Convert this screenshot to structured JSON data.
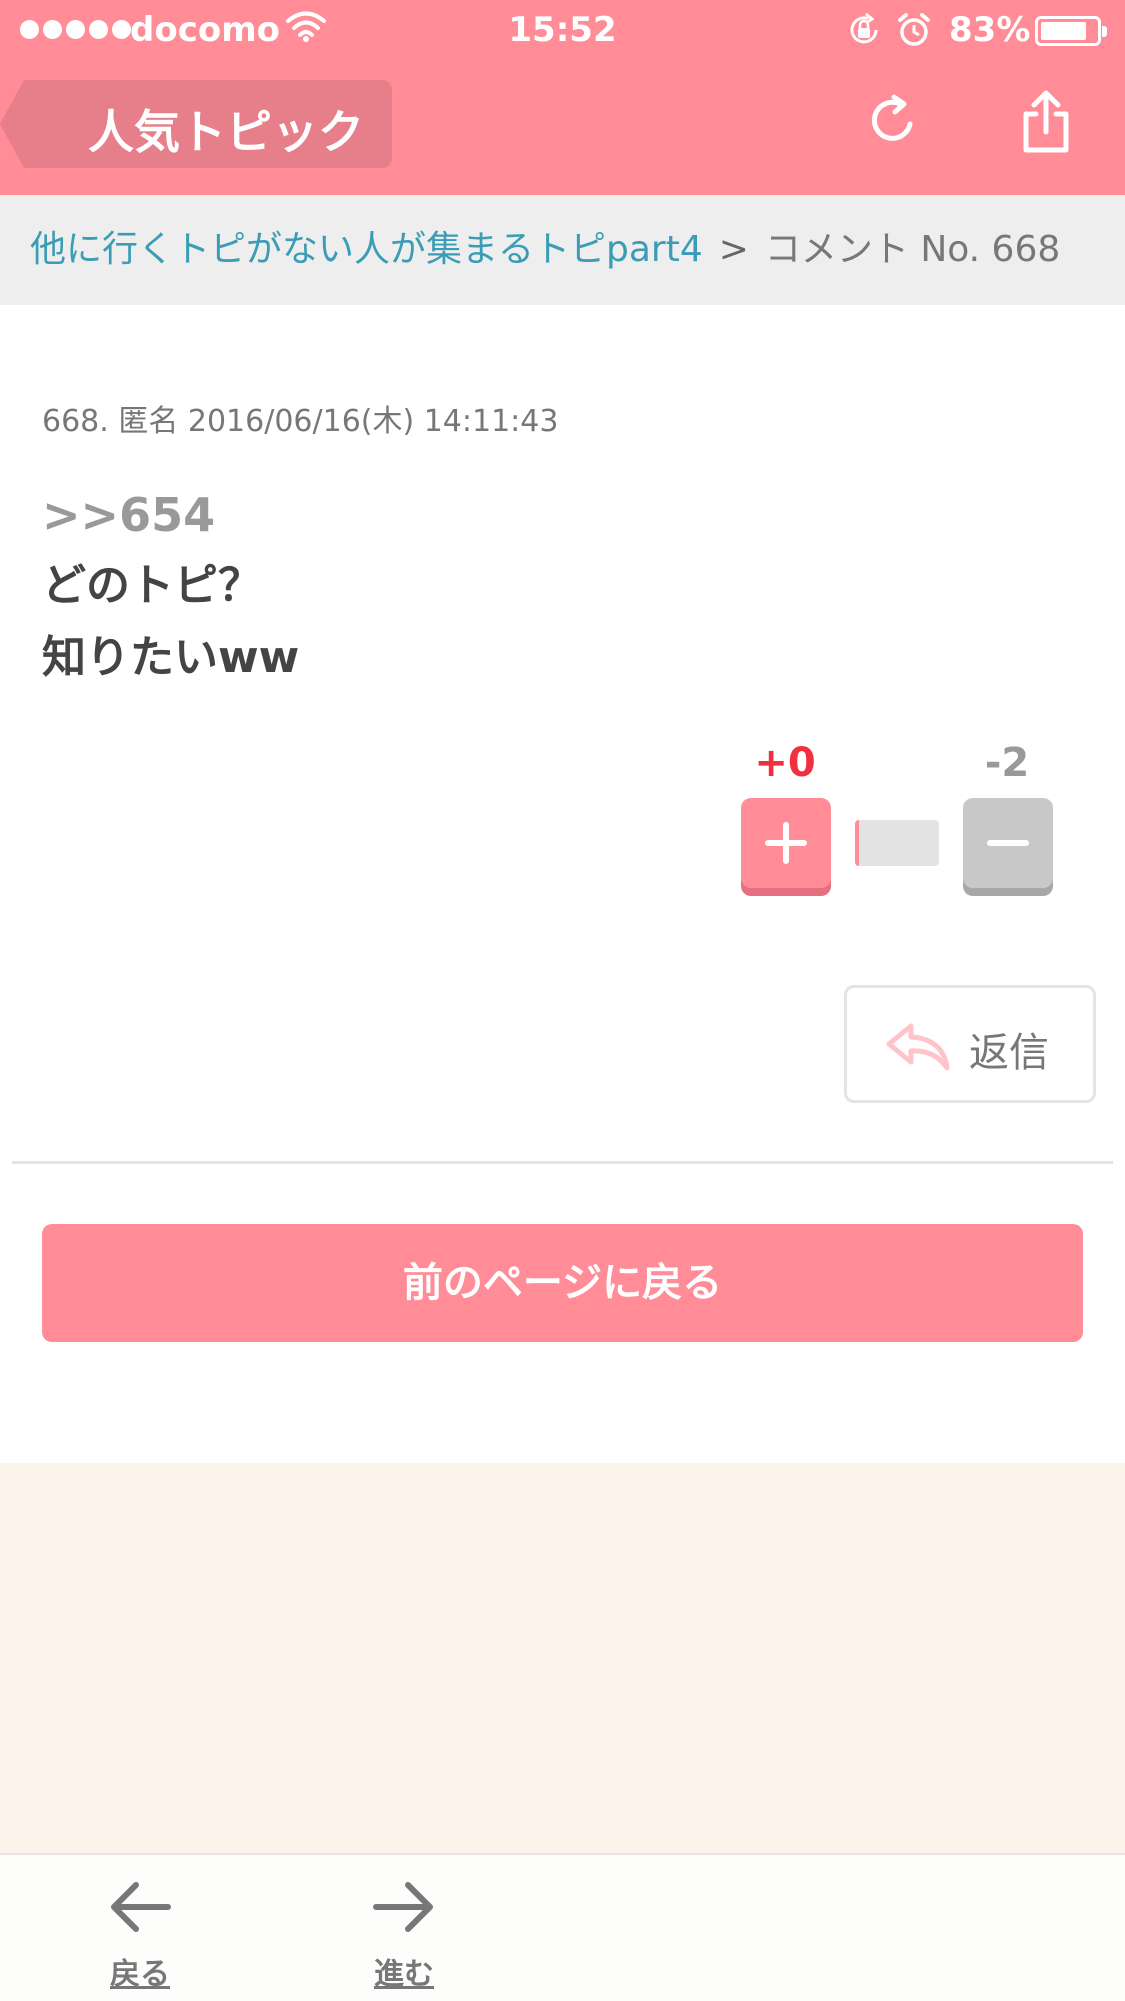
{
  "status_bar": {
    "carrier": "docomo",
    "time": "15:52",
    "battery_percent_label": "83%",
    "battery_level": 0.83,
    "signal_bars": 5,
    "icons": [
      "signal-dots-icon",
      "wifi-icon",
      "rotation-lock-icon",
      "alarm-icon",
      "battery-icon"
    ]
  },
  "nav": {
    "back_label": "人気トピック",
    "reload_icon": "reload-icon",
    "share_icon": "share-icon"
  },
  "breadcrumb": {
    "topic": "他に行くトピがない人が集まるトピpart4",
    "separator": ">",
    "current": "コメント No. 668"
  },
  "comment": {
    "meta": "668. 匿名 2016/06/16(木) 14:11:43",
    "anchor": ">>654",
    "lines": [
      "どのトピ？",
      "知りたいww"
    ],
    "plus_count": "+0",
    "minus_count": "-2",
    "plus_share": 0.05,
    "reply_label": "返信"
  },
  "prev_page_label": "前のページに戻る",
  "toolbar": {
    "back_label": "戻る",
    "forward_label": "進む"
  },
  "colors": {
    "header_pink": "#ff8c96",
    "back_button_pink": "#e67f89",
    "link_blue": "#3b9db5",
    "plus_red": "#f0303e",
    "cream": "#fcf4eb"
  }
}
